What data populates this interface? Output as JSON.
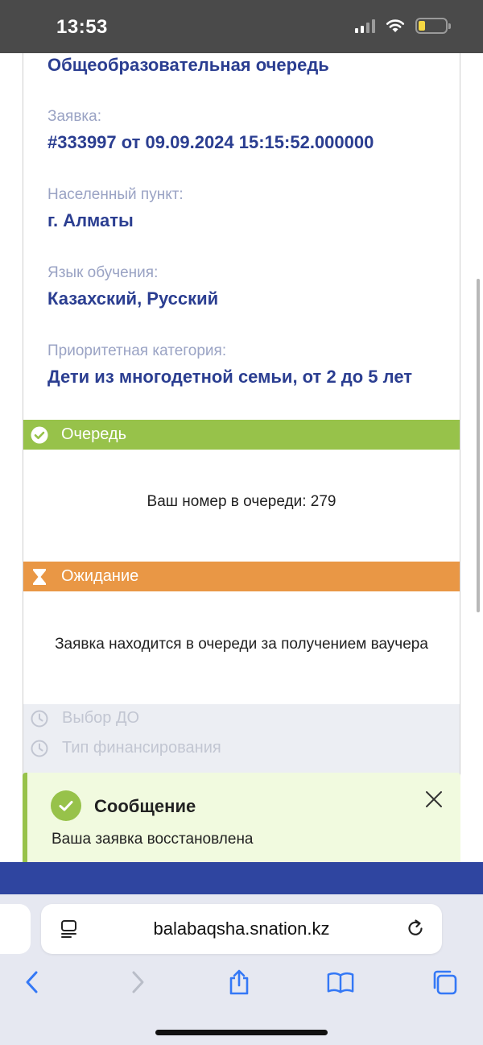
{
  "status_bar": {
    "time": "13:53"
  },
  "application": {
    "queue_type": "Общеобразовательная очередь",
    "fields": [
      {
        "label": "Заявка:",
        "value": "#333997 от 09.09.2024 15:15:52.000000"
      },
      {
        "label": "Населенный пункт:",
        "value": "г. Алматы"
      },
      {
        "label": "Язык обучения:",
        "value": "Казахский, Русский"
      },
      {
        "label": "Приоритетная категория:",
        "value": "Дети из многодетной семьи, от 2 до 5 лет"
      }
    ]
  },
  "steps": {
    "queue": {
      "title": "Очередь",
      "text": "Ваш номер в очереди: 279",
      "color": "#97c24a"
    },
    "waiting": {
      "title": "Ожидание",
      "text": "Заявка находится в очереди за получением ваучера",
      "color": "#e99745"
    },
    "pending": [
      {
        "title": "Выбор ДО"
      },
      {
        "title": "Тип финансирования"
      }
    ]
  },
  "toast": {
    "title": "Сообщение",
    "message": "Ваша заявка восстановлена"
  },
  "browser": {
    "url": "balabaqsha.snation.kz"
  }
}
